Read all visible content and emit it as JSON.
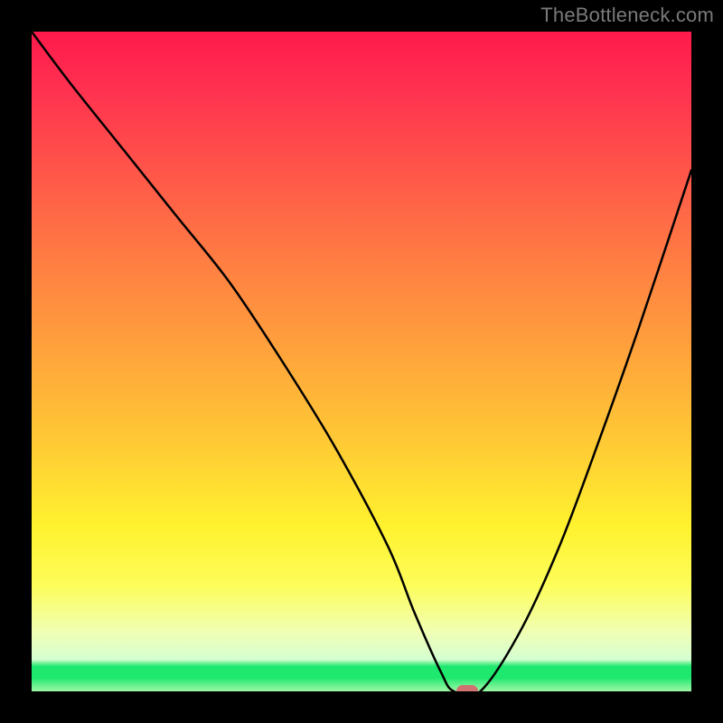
{
  "watermark": "TheBottleneck.com",
  "chart_data": {
    "type": "line",
    "title": "",
    "xlabel": "",
    "ylabel": "",
    "x_range": [
      0,
      100
    ],
    "y_range": [
      0,
      100
    ],
    "series": [
      {
        "name": "bottleneck-curve",
        "x": [
          0,
          6,
          14,
          22,
          30,
          38,
          46,
          54,
          58,
          62,
          64,
          68,
          74,
          80,
          86,
          92,
          100
        ],
        "values": [
          100,
          92,
          82,
          72,
          62,
          50,
          37,
          22,
          12,
          3,
          0,
          0,
          9,
          22,
          38,
          55,
          79
        ]
      }
    ],
    "marker": {
      "x": 66,
      "y": 0,
      "color": "#d56a6f"
    },
    "background_gradient": {
      "stops": [
        {
          "pos": 0.0,
          "color": "#ff1a4b"
        },
        {
          "pos": 0.5,
          "color": "#ffa73b"
        },
        {
          "pos": 0.78,
          "color": "#fff22e"
        },
        {
          "pos": 0.93,
          "color": "#e9ffc6"
        },
        {
          "pos": 0.97,
          "color": "#1fe86f"
        },
        {
          "pos": 1.0,
          "color": "#9bf7a2"
        }
      ]
    },
    "grid": false,
    "legend": false
  }
}
